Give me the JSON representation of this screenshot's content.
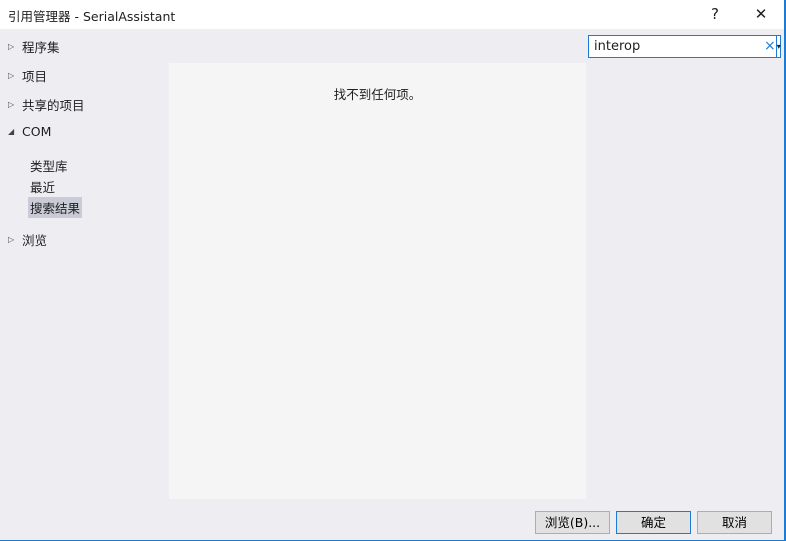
{
  "window": {
    "title": "引用管理器 - SerialAssistant",
    "help": "?",
    "close": "✕"
  },
  "tree": [
    {
      "label": "程序集",
      "expanded": false
    },
    {
      "label": "项目",
      "expanded": false
    },
    {
      "label": "共享的项目",
      "expanded": false
    },
    {
      "label": "COM",
      "expanded": true,
      "children": [
        {
          "label": "类型库"
        },
        {
          "label": "最近"
        },
        {
          "label": "搜索结果",
          "selected": true
        }
      ]
    },
    {
      "label": "浏览",
      "expanded": false
    }
  ],
  "search": {
    "value": "interop",
    "clear": "×",
    "dropdown": "▾"
  },
  "main": {
    "empty_message": "找不到任何项。"
  },
  "buttons": {
    "browse": "浏览(B)...",
    "ok": "确定",
    "cancel": "取消"
  },
  "colors": {
    "accent": "#1e7bd4",
    "selected": "#c9cbd6"
  }
}
